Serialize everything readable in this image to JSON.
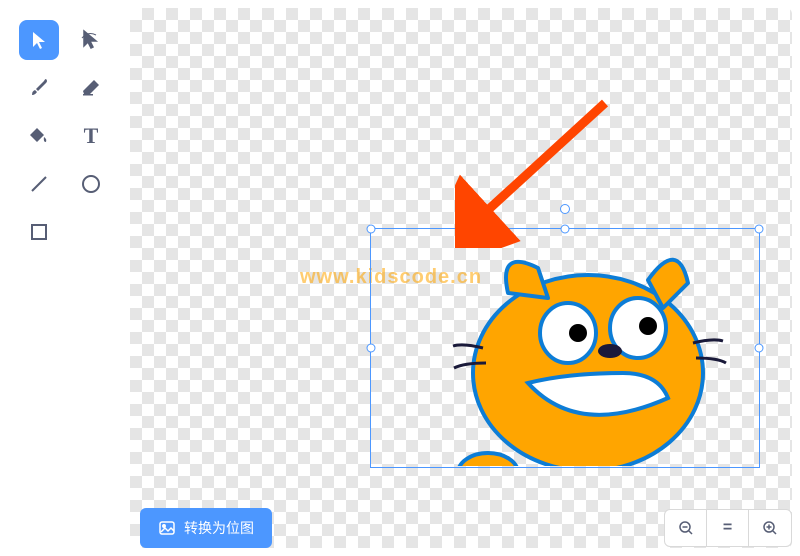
{
  "tools": {
    "select": "select",
    "reshape": "reshape",
    "brush": "brush",
    "eraser": "eraser",
    "fill": "fill",
    "text": "text",
    "line": "line",
    "circle": "circle",
    "rectangle": "rectangle"
  },
  "watermark": "www.kidscode.cn",
  "buttons": {
    "bitmap_label": "转换为位图"
  },
  "zoom": {
    "out": "−",
    "reset": "=",
    "in": "+"
  },
  "colors": {
    "primary": "#4c97ff",
    "arrow": "#ff4500",
    "cat_body": "#ffa500",
    "cat_outline": "#1e90ff"
  },
  "text_tool_glyph": "T"
}
